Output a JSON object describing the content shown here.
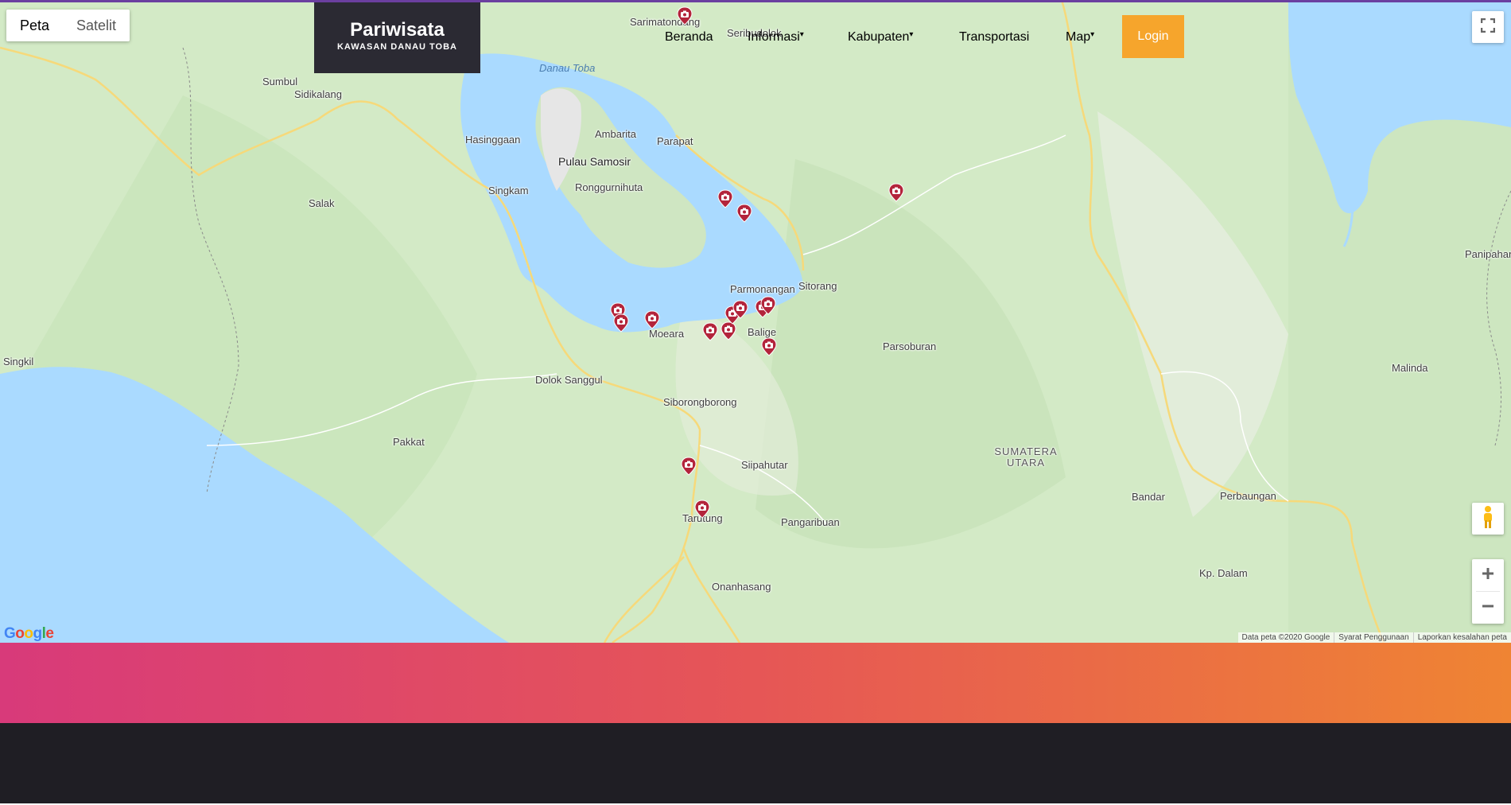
{
  "map": {
    "map_types": [
      {
        "label": "Peta",
        "active": true
      },
      {
        "label": "Satelit",
        "active": false
      }
    ],
    "places": [
      {
        "label": "Sarimatondang",
        "cls": ""
      },
      {
        "label": "Seribudolok",
        "cls": ""
      },
      {
        "label": "Sumbul",
        "cls": ""
      },
      {
        "label": "Sidikalang",
        "cls": ""
      },
      {
        "label": "Danau Toba",
        "cls": "water"
      },
      {
        "label": "Ambarita",
        "cls": ""
      },
      {
        "label": "Hasinggaan",
        "cls": ""
      },
      {
        "label": "Parapat",
        "cls": ""
      },
      {
        "label": "Pulau Samosir",
        "cls": "big"
      },
      {
        "label": "Singkam",
        "cls": ""
      },
      {
        "label": "Ronggurnihuta",
        "cls": ""
      },
      {
        "label": "Salak",
        "cls": ""
      },
      {
        "label": "Parmonangan",
        "cls": ""
      },
      {
        "label": "Sitorang",
        "cls": ""
      },
      {
        "label": "Panipahan",
        "cls": ""
      },
      {
        "label": "Moeara",
        "cls": ""
      },
      {
        "label": "Balige",
        "cls": ""
      },
      {
        "label": "Parsoburan",
        "cls": ""
      },
      {
        "label": "Singkil",
        "cls": ""
      },
      {
        "label": "Dolok Sanggul",
        "cls": ""
      },
      {
        "label": "Malinda",
        "cls": ""
      },
      {
        "label": "Siborongborong",
        "cls": ""
      },
      {
        "label": "Pakkat",
        "cls": ""
      },
      {
        "label": "SUMATERA UTARA",
        "cls": "region"
      },
      {
        "label": "Siipahutar",
        "cls": ""
      },
      {
        "label": "Bandar",
        "cls": ""
      },
      {
        "label": "Perbaungan",
        "cls": ""
      },
      {
        "label": "Tarutung",
        "cls": ""
      },
      {
        "label": "Pangaribuan",
        "cls": ""
      },
      {
        "label": "Kp. Dalam",
        "cls": ""
      },
      {
        "label": "Onanhasang",
        "cls": ""
      }
    ],
    "marker_icon": "camera-marker-icon",
    "google_logo": "Google",
    "attribution": {
      "data": "Data peta ©2020 Google",
      "terms": "Syarat Penggunaan",
      "report": "Laporkan kesalahan peta"
    },
    "colors": {
      "water": "#aadaff",
      "land": "#cfe8c2",
      "marker": "#b3243b",
      "road": "#f6d97a"
    }
  },
  "brand": {
    "title": "Pariwisata",
    "subtitle": "KAWASAN DANAU TOBA"
  },
  "nav": {
    "items": [
      {
        "label": "Beranda",
        "dropdown": false
      },
      {
        "label": "Informasi",
        "dropdown": true
      },
      {
        "label": "Kabupaten",
        "dropdown": true
      },
      {
        "label": "Transportasi",
        "dropdown": false
      },
      {
        "label": "Map",
        "dropdown": true
      }
    ],
    "login_label": "Login",
    "colors": {
      "login": "#f6a52c",
      "brand_bg": "#2b2a33"
    }
  },
  "sections": {
    "gradient_colors": [
      "#d83a7a",
      "#e65656",
      "#ef8433"
    ],
    "footer_bg": "#1f1e24"
  }
}
